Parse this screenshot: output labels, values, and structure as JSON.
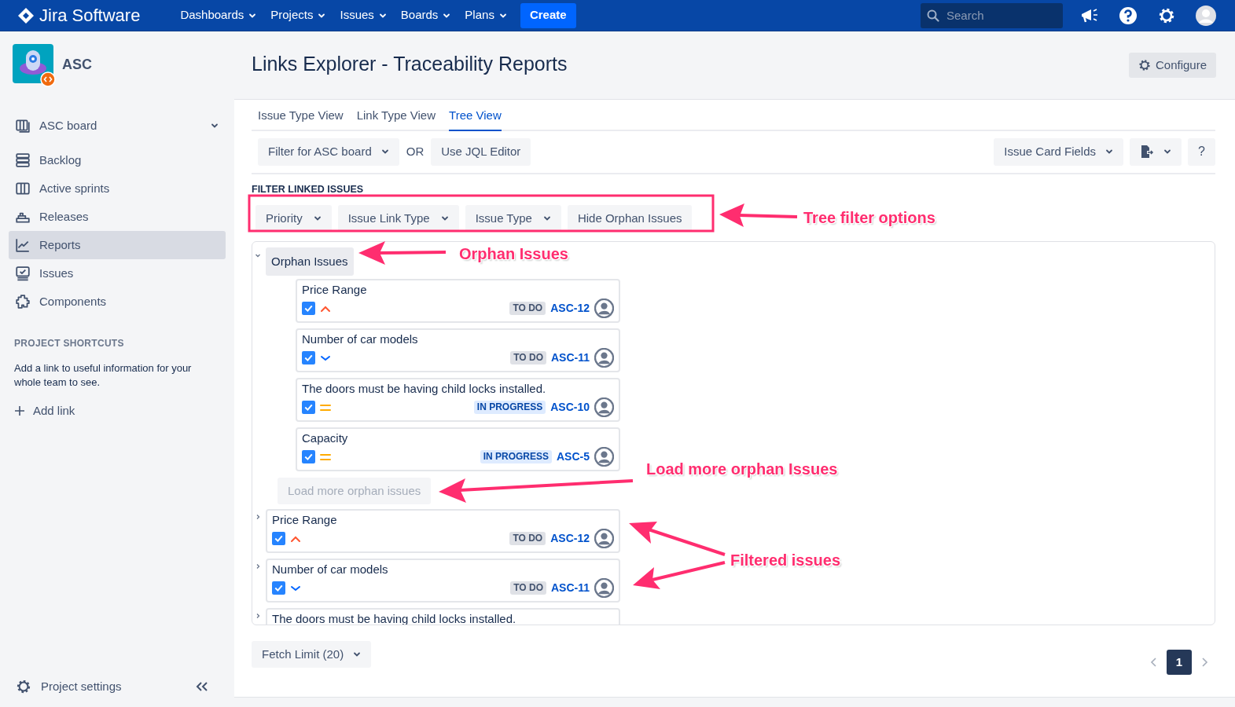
{
  "topbar": {
    "product": "Jira Software",
    "nav": [
      {
        "label": "Dashboards"
      },
      {
        "label": "Projects"
      },
      {
        "label": "Issues"
      },
      {
        "label": "Boards"
      },
      {
        "label": "Plans"
      }
    ],
    "create": "Create",
    "search": {
      "placeholder": "Search"
    }
  },
  "sidebar": {
    "project": "ASC",
    "board": "ASC board",
    "items": [
      {
        "label": "Backlog",
        "kind": "backlog",
        "selected": false
      },
      {
        "label": "Active sprints",
        "kind": "sprints",
        "selected": false
      },
      {
        "label": "Releases",
        "kind": "releases",
        "selected": false
      },
      {
        "label": "Reports",
        "kind": "reports",
        "selected": true
      },
      {
        "label": "Issues",
        "kind": "issues",
        "selected": false
      },
      {
        "label": "Components",
        "kind": "components",
        "selected": false
      }
    ],
    "shortcuts_heading": "PROJECT SHORTCUTS",
    "shortcuts_text": "Add a link to useful information for your whole team to see.",
    "add_link": "Add link",
    "settings": "Project settings"
  },
  "page": {
    "title": "Links Explorer - Traceability Reports",
    "configure": "Configure"
  },
  "tabs": [
    {
      "label": "Issue Type View",
      "selected": false
    },
    {
      "label": "Link Type View",
      "selected": false
    },
    {
      "label": "Tree View",
      "selected": true
    }
  ],
  "toolbar": {
    "filter": "Filter for ASC board",
    "or": "OR",
    "jql": "Use JQL Editor",
    "card_fields": "Issue Card Fields",
    "help": "?"
  },
  "filter_section": {
    "heading": "FILTER LINKED ISSUES",
    "buttons": [
      {
        "label": "Priority",
        "dropdown": true
      },
      {
        "label": "Issue Link Type",
        "dropdown": true
      },
      {
        "label": "Issue Type",
        "dropdown": true
      },
      {
        "label": "Hide Orphan Issues",
        "dropdown": false
      }
    ]
  },
  "tree": {
    "orphan_group": {
      "label": "Orphan Issues",
      "expanded": true,
      "issues": [
        {
          "summary": "Price Range",
          "priority": {
            "kind": "high"
          },
          "status": {
            "label": "TO DO",
            "kind": "todo"
          },
          "key": "ASC-12"
        },
        {
          "summary": "Number of car models",
          "priority": {
            "kind": "low"
          },
          "status": {
            "label": "TO DO",
            "kind": "todo"
          },
          "key": "ASC-11"
        },
        {
          "summary": "The doors must be having child locks installed.",
          "priority": {
            "kind": "medium"
          },
          "status": {
            "label": "IN PROGRESS",
            "kind": "inprogress"
          },
          "key": "ASC-10"
        },
        {
          "summary": "Capacity",
          "priority": {
            "kind": "medium"
          },
          "status": {
            "label": "IN PROGRESS",
            "kind": "inprogress"
          },
          "key": "ASC-5"
        }
      ]
    },
    "load_more": {
      "label": "Load more orphan issues",
      "disabled": true
    },
    "issues": [
      {
        "summary": "Price Range",
        "expanded": false,
        "priority": {
          "kind": "high"
        },
        "status": {
          "label": "TO DO",
          "kind": "todo"
        },
        "key": "ASC-12"
      },
      {
        "summary": "Number of car models",
        "expanded": false,
        "priority": {
          "kind": "low"
        },
        "status": {
          "label": "TO DO",
          "kind": "todo"
        },
        "key": "ASC-11"
      },
      {
        "summary": "The doors must be having child locks installed.",
        "expanded": false
      }
    ]
  },
  "fetch_limit": "Fetch Limit (20)",
  "pagination": {
    "pages": [
      {
        "label": "1",
        "selected": true
      }
    ]
  },
  "annotations": [
    {
      "text": "Tree filter options"
    },
    {
      "text": "Orphan Issues"
    },
    {
      "text": "Load more orphan Issues"
    },
    {
      "text": "Filtered issues"
    }
  ]
}
